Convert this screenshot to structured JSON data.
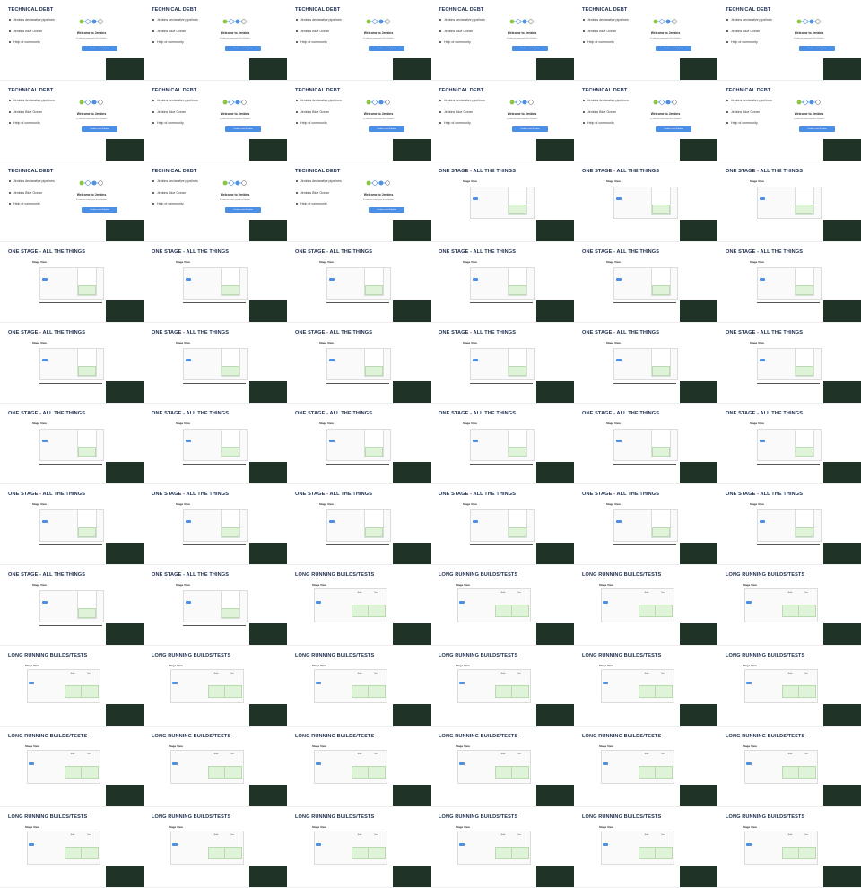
{
  "slides": {
    "technical_debt": {
      "title": "TECHNICAL DEBT",
      "bullets": [
        "Jenkins declarative pipelines",
        "Jenkins Blue Ocean",
        "Help of community"
      ],
      "welcome_title": "Welcome to Jenkins",
      "welcome_sub": "It's time to create your first Pipeline",
      "create_button": "Create a new Pipeline"
    },
    "one_stage": {
      "title": "ONE STAGE - ALL THE THINGS",
      "stage_view": "Stage View"
    },
    "long_running": {
      "title": "LONG RUNNING BUILDS/TESTS",
      "stage_view": "Stage View",
      "col_build": "Build",
      "col_test": "Test"
    }
  },
  "grid": {
    "columns": 6,
    "rows": 11,
    "sequence": [
      {
        "type": "technical_debt",
        "count": 15
      },
      {
        "type": "one_stage",
        "count": 29
      },
      {
        "type": "long_running",
        "count": 22
      }
    ]
  },
  "colors": {
    "title": "#1f2f4f",
    "accent_blue": "#4a8ee6",
    "stage_green": "#dff3d8",
    "video_bg": "#1f3326"
  }
}
